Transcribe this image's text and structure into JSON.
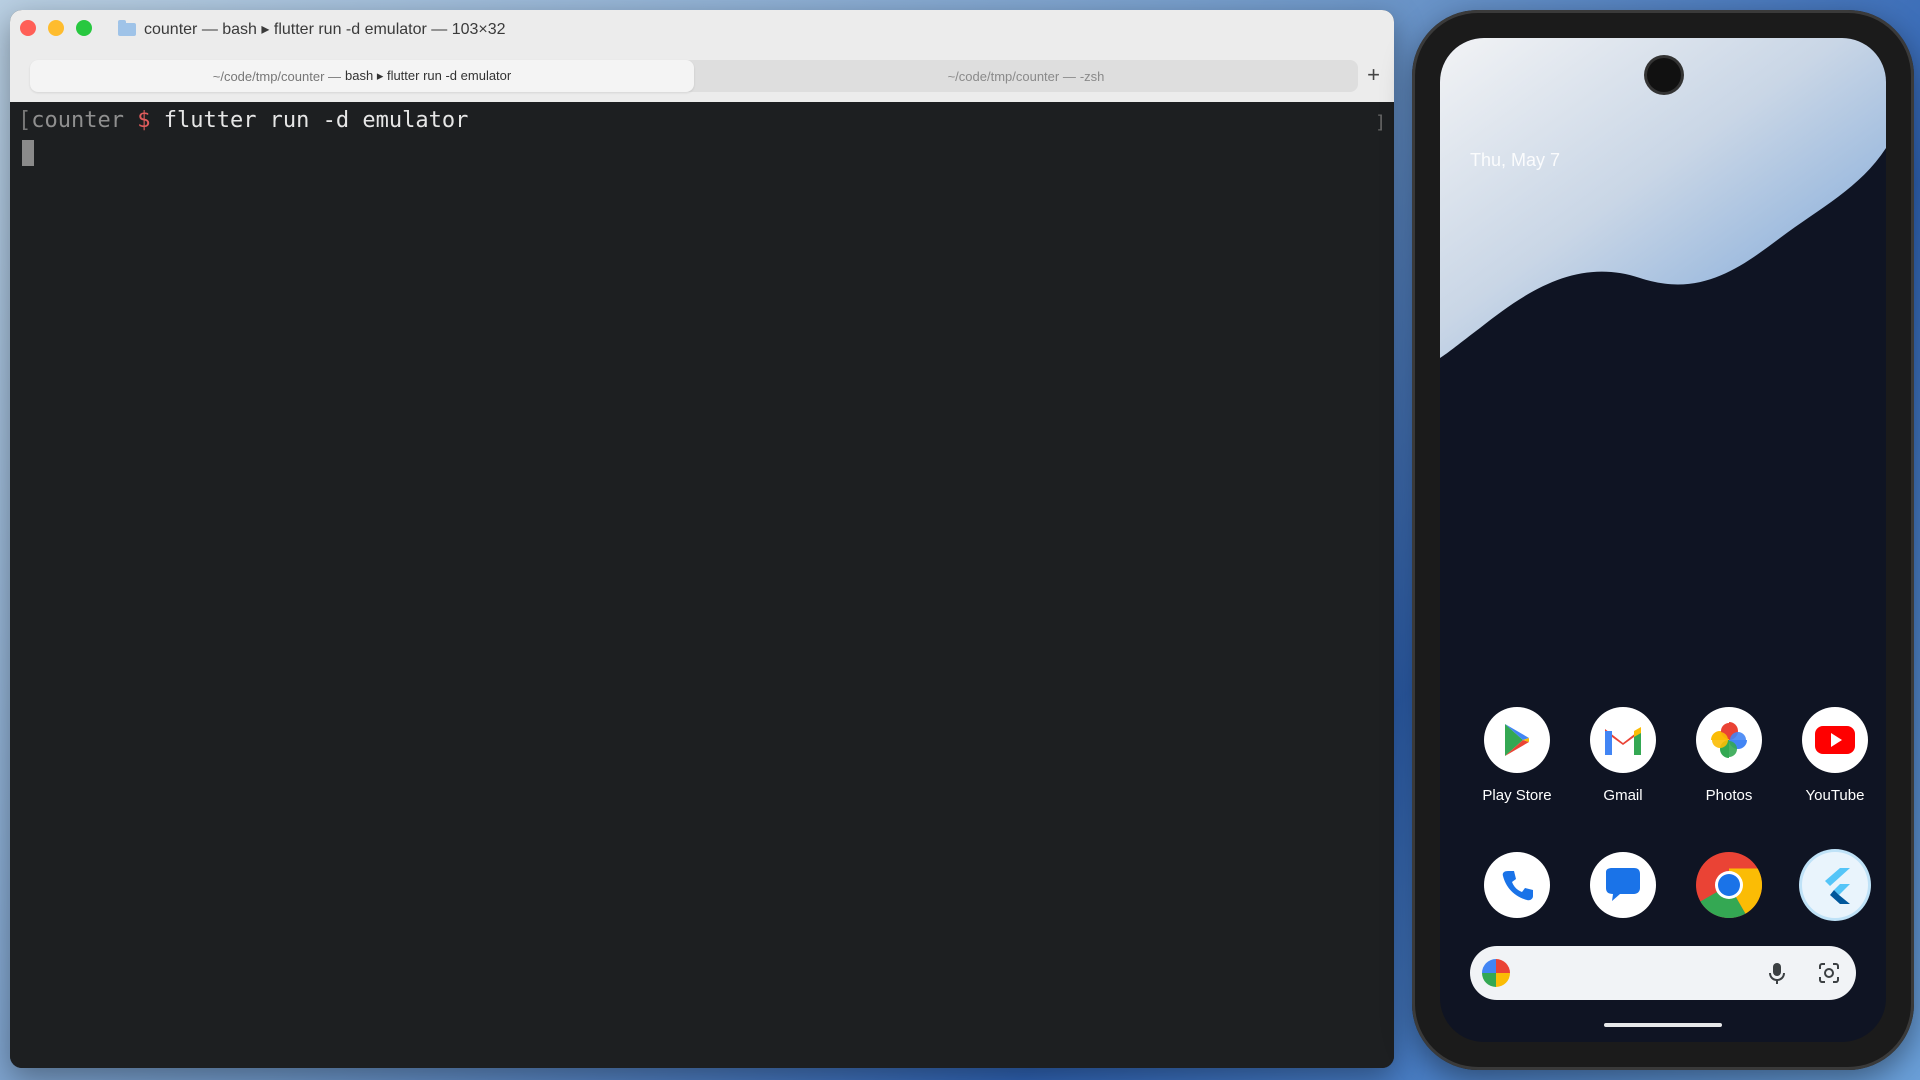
{
  "terminal": {
    "title": "counter — bash ▸ flutter run -d emulator — 103×32",
    "tabs": [
      {
        "path": "~/code/tmp/counter —",
        "name": "bash ▸ flutter run -d emulator"
      },
      {
        "path": "~/code/tmp/counter —",
        "name": "-zsh"
      }
    ],
    "add_tab": "+",
    "prompt": {
      "open_bracket": "[",
      "cwd": "counter",
      "symbol": "$",
      "command": "flutter run -d emulator"
    },
    "right_marker": "]"
  },
  "phone": {
    "date": "Thu, May 7",
    "apps_row1": [
      {
        "label": "Play Store",
        "icon": "play-store-icon"
      },
      {
        "label": "Gmail",
        "icon": "gmail-icon"
      },
      {
        "label": "Photos",
        "icon": "photos-icon"
      },
      {
        "label": "YouTube",
        "icon": "youtube-icon"
      }
    ],
    "apps_row2": [
      {
        "label": "",
        "icon": "phone-icon"
      },
      {
        "label": "",
        "icon": "messages-icon"
      },
      {
        "label": "",
        "icon": "chrome-icon"
      },
      {
        "label": "",
        "icon": "flutter-icon"
      }
    ],
    "search_icons": [
      "google-icon",
      "mic-icon",
      "lens-icon"
    ]
  },
  "colors": {
    "terminal_bg": "#1d1f21",
    "prompt_dollar": "#e05c5c",
    "traffic_red": "#ff5f57",
    "traffic_yellow": "#febc2e",
    "traffic_green": "#28c840"
  }
}
